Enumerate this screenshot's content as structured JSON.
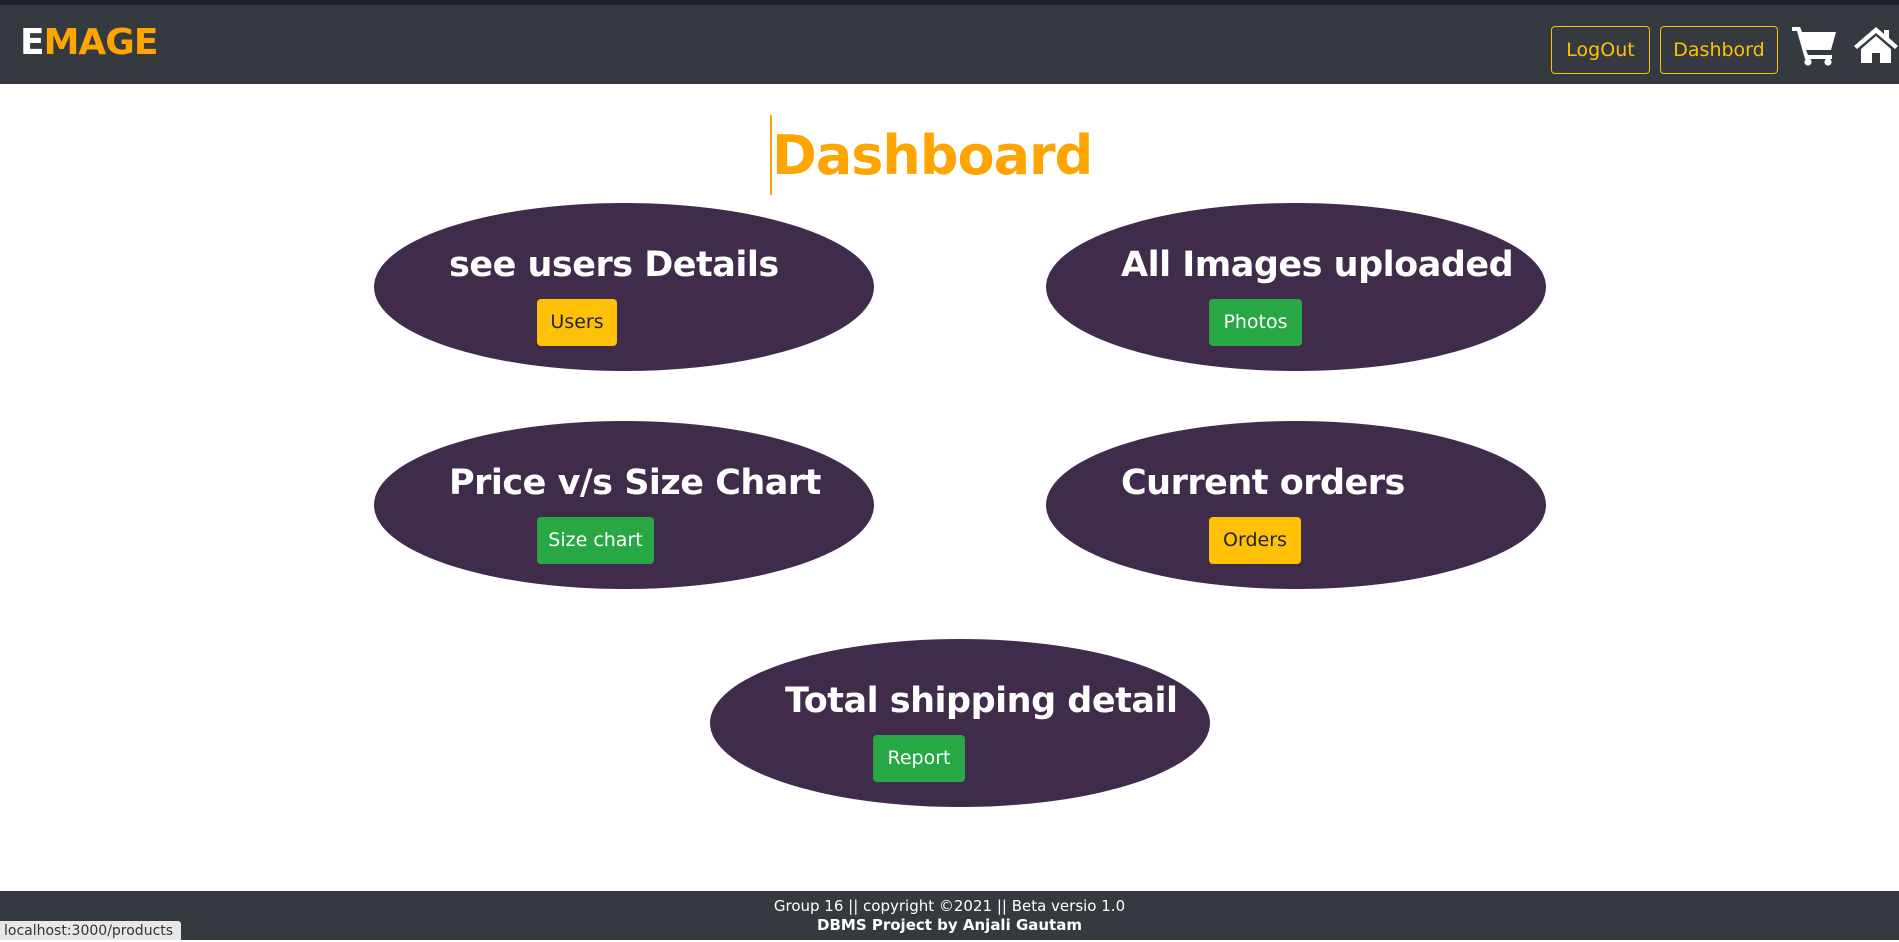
{
  "brand": {
    "first_letter": "E",
    "rest": "MAGE"
  },
  "nav": {
    "logout_label": "LogOut",
    "dashboard_label": "Dashbord",
    "cart_icon": "cart-icon",
    "home_icon": "home-icon"
  },
  "page_title": "Dashboard",
  "cards": [
    {
      "title": "see users Details",
      "button_label": "Users",
      "button_style": "warning"
    },
    {
      "title": "All Images uploaded",
      "button_label": "Photos",
      "button_style": "success"
    },
    {
      "title": "Price v/s Size Chart",
      "button_label": "Size chart",
      "button_style": "success"
    },
    {
      "title": "Current orders",
      "button_label": "Orders",
      "button_style": "warning"
    },
    {
      "title": "Total shipping detail",
      "button_label": "Report",
      "button_style": "success"
    }
  ],
  "footer": {
    "line1": "Group 16 || copyright ©2021 || Beta versio 1.0",
    "line2": "DBMS Project by Anjali Gautam"
  },
  "status_bar_url": "localhost:3000/products",
  "colors": {
    "navbar": "#343a40",
    "accent": "#ffa500",
    "card_background": "#412b4b",
    "warning": "#ffc107",
    "success": "#28a745"
  }
}
